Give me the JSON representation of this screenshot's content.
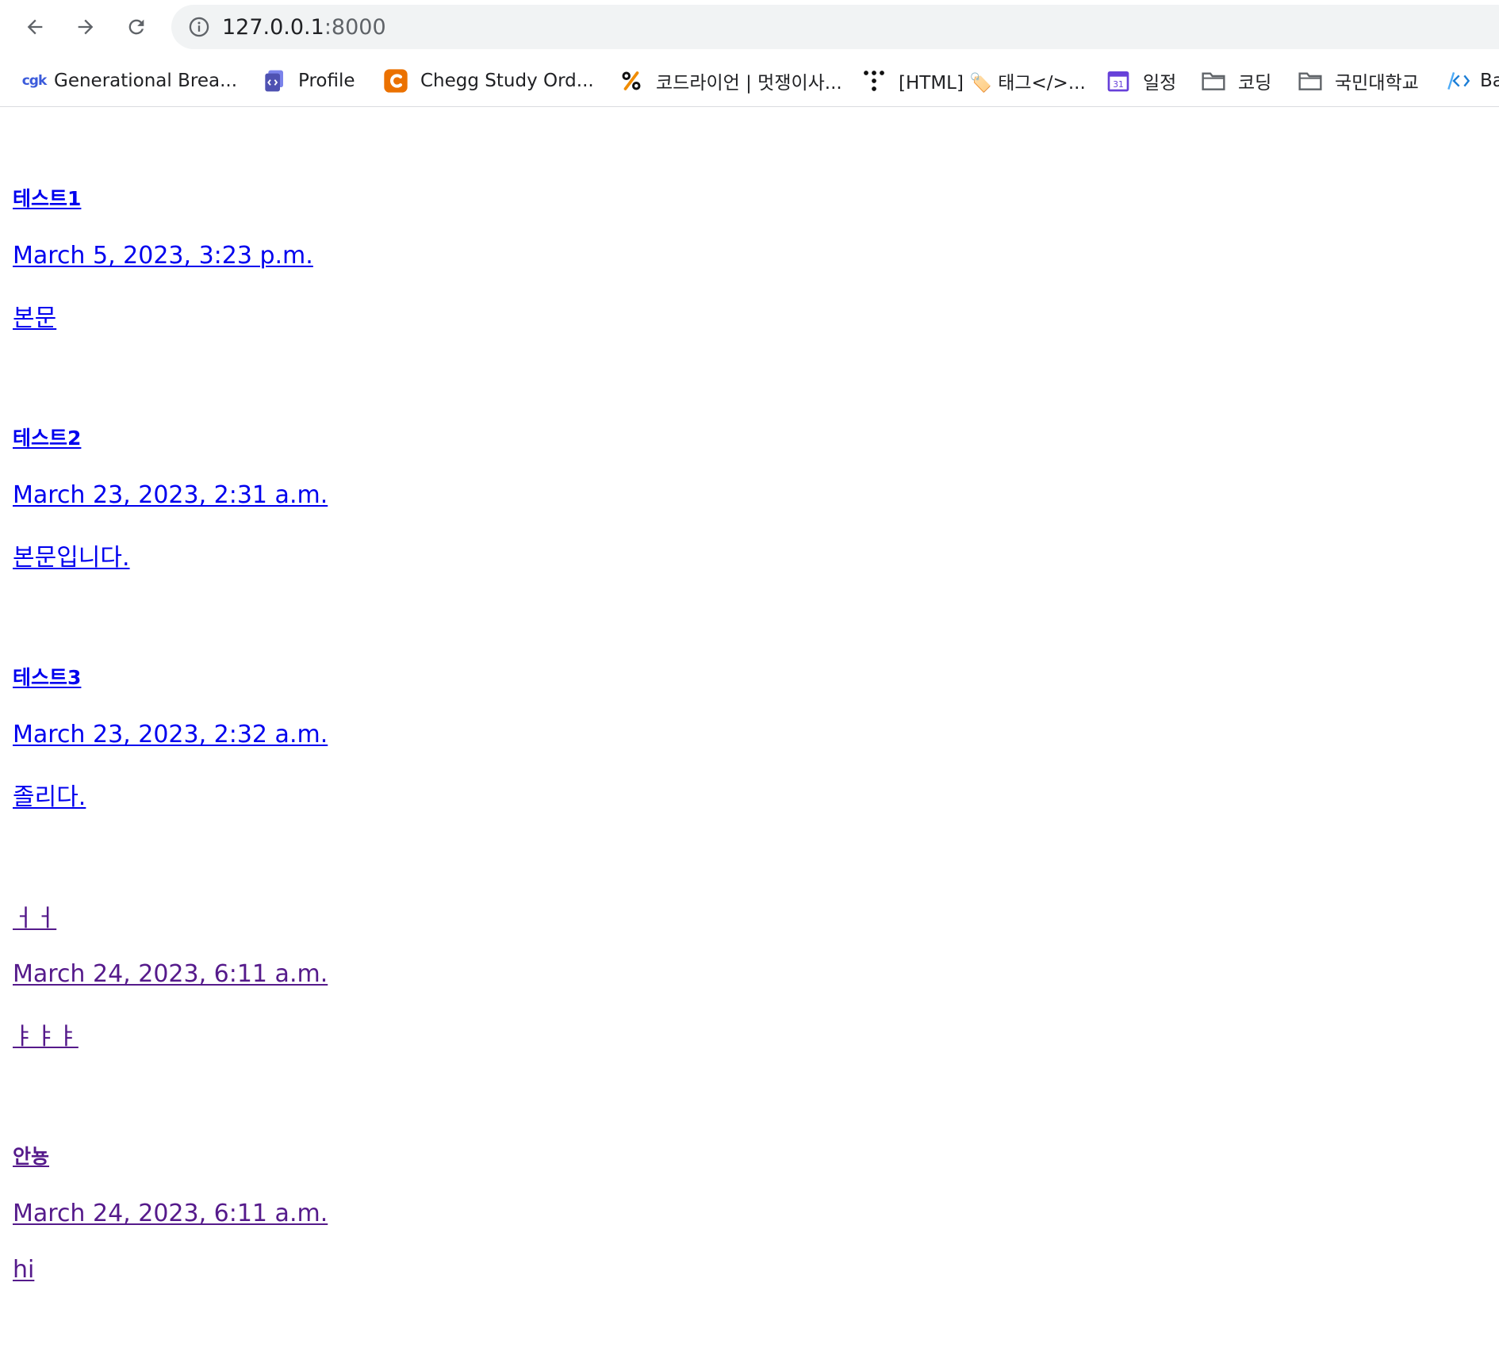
{
  "browser": {
    "url_host": "127.0.0.1",
    "url_port": ":8000"
  },
  "bookmarks": [
    {
      "label": "Generational Brea...",
      "icon": "cgk-icon"
    },
    {
      "label": "Profile",
      "icon": "profile-icon"
    },
    {
      "label": "Chegg Study Ord...",
      "icon": "chegg-icon"
    },
    {
      "label": "코드라이언 | 멋쟁이사...",
      "icon": "percent-icon"
    },
    {
      "label": "[HTML] 🏷️ 태그</>...",
      "icon": "dots-icon"
    },
    {
      "label": "일정",
      "icon": "calendar-icon"
    },
    {
      "label": "코딩",
      "icon": "folder-icon"
    },
    {
      "label": "국민대학교",
      "icon": "folder-icon"
    },
    {
      "label": "Ba",
      "icon": "code-icon"
    }
  ],
  "calendar_icon_text": "31",
  "cgk_icon_text": "cgk",
  "colors": {
    "link": "#0000ee",
    "visited": "#551a8b"
  },
  "posts": [
    {
      "title": "테스트1",
      "date": "March 5, 2023, 3:23 p.m.",
      "body": "본문"
    },
    {
      "title": "테스트2",
      "date": "March 23, 2023, 2:31 a.m.",
      "body": "본문입니다."
    },
    {
      "title": "테스트3",
      "date": "March 23, 2023, 2:32 a.m.",
      "body": "졸리다."
    },
    {
      "title": "ㅓㅓ",
      "date": "March 24, 2023, 6:11 a.m.",
      "body": "ㅑㅑㅑ"
    },
    {
      "title": "안뇽",
      "date": "March 24, 2023, 6:11 a.m.",
      "body": "hi"
    }
  ]
}
